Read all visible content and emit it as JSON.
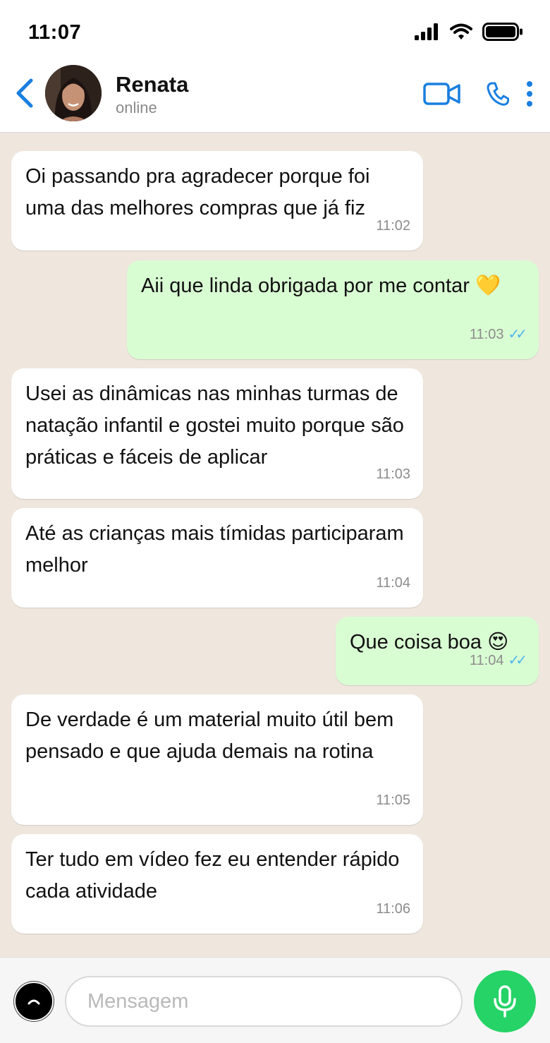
{
  "status_bar": {
    "time": "11:07"
  },
  "header": {
    "contact_name": "Renata",
    "contact_status": "online"
  },
  "messages": [
    {
      "direction": "in",
      "text": "Oi passando pra agradecer porque foi uma das melhores compras que já fiz",
      "time": "11:02"
    },
    {
      "direction": "out",
      "text": "Aii que linda obrigada por me contar 💛",
      "time": "11:03",
      "ticks": "✓✓"
    },
    {
      "direction": "in",
      "text": "Usei as dinâmicas nas minhas turmas de natação infantil e gostei muito porque são práticas e fáceis de aplicar",
      "time": "11:03"
    },
    {
      "direction": "in",
      "text": "Até as crianças mais tímidas participaram melhor",
      "time": "11:04"
    },
    {
      "direction": "out",
      "text": "Que coisa boa 😍",
      "time": "11:04",
      "ticks": "✓✓"
    },
    {
      "direction": "in",
      "text": "De verdade é um material muito útil bem pensado e que ajuda demais na rotina",
      "time": "11:05"
    },
    {
      "direction": "in",
      "text": "Ter tudo em vídeo fez eu entender rápido cada atividade",
      "time": "11:06"
    }
  ],
  "composer": {
    "placeholder": "Mensagem",
    "value": ""
  },
  "icons": {
    "status": [
      "signal-icon",
      "wifi-icon",
      "battery-icon"
    ],
    "header": [
      "back-chevron-icon",
      "video-call-icon",
      "phone-icon",
      "more-vertical-icon"
    ],
    "composer": [
      "emoji-icon",
      "microphone-icon"
    ]
  },
  "colors": {
    "chat_background": "#efe7de",
    "incoming_bubble": "#ffffff",
    "outgoing_bubble": "#d9fdd3",
    "accent_blue": "#1a7fe0",
    "read_ticks": "#4fb6ec",
    "mic_button": "#25d366"
  }
}
